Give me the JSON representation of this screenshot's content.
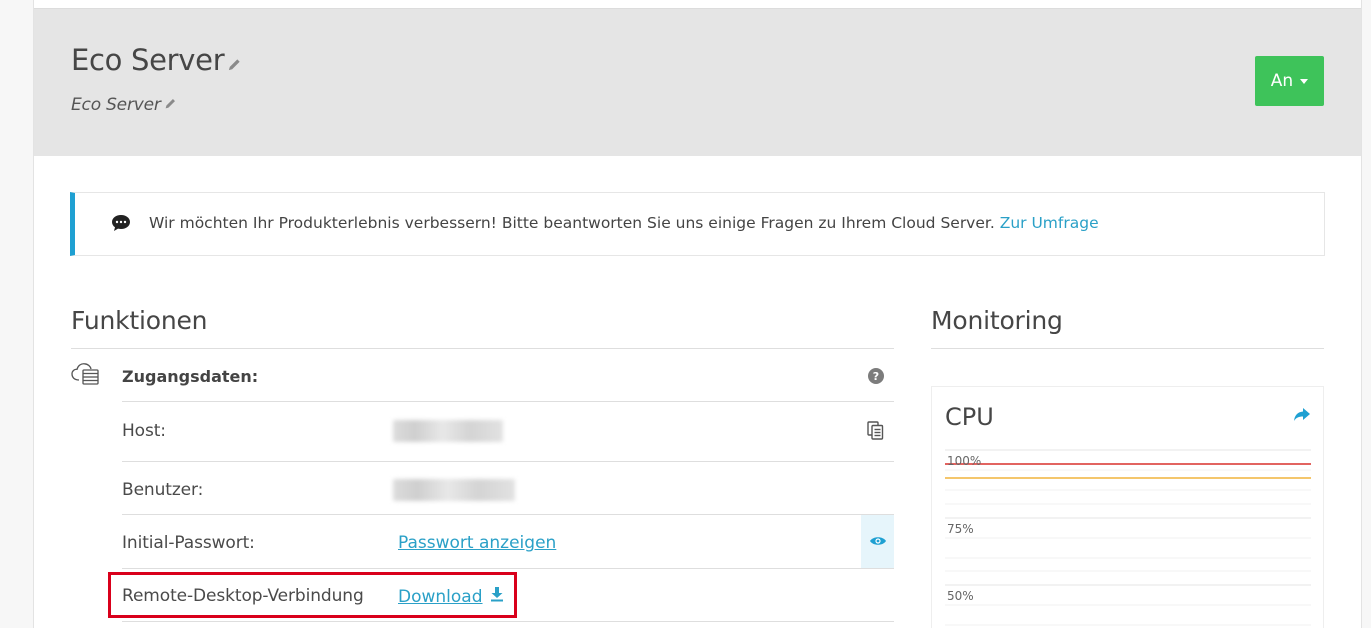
{
  "header": {
    "title": "Eco Server",
    "subtitle": "Eco Server",
    "status_button": "An"
  },
  "alert": {
    "icon": "chat-bubble-icon",
    "message": "Wir möchten Ihr Produkterlebnis verbessern! Bitte beantworten Sie uns einige Fragen zu Ihrem Cloud Server.",
    "link": "Zur Umfrage",
    "accent_color": "#1fa0d2"
  },
  "functions": {
    "title": "Funktionen",
    "access": {
      "heading": "Zugangsdaten:",
      "rows": [
        {
          "label": "Host:"
        },
        {
          "label": "Benutzer:"
        },
        {
          "label": "Initial-Passwort:",
          "link": "Passwort anzeigen"
        },
        {
          "label": "Remote-Desktop-Verbindung",
          "link": "Download"
        }
      ]
    }
  },
  "monitoring": {
    "title": "Monitoring",
    "cpu": {
      "title": "CPU",
      "ticks": [
        "100%",
        "75%",
        "50%"
      ],
      "threshold_colors": {
        "critical": "#d9302c",
        "warning": "#f0b43c"
      }
    }
  },
  "colors": {
    "status_on": "#3ec35a",
    "link": "#2aa0c7",
    "highlight": "#d9001b"
  }
}
